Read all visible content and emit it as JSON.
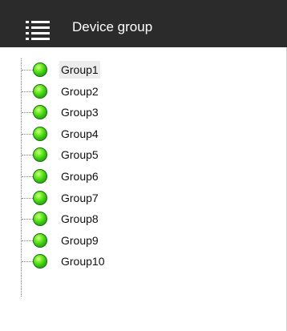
{
  "header": {
    "icon": "list-icon",
    "title": "Device group"
  },
  "tree": {
    "status_color": "#33c20f",
    "selected_index": 0,
    "items": [
      {
        "label": "Group1",
        "status": "online"
      },
      {
        "label": "Group2",
        "status": "online"
      },
      {
        "label": "Group3",
        "status": "online"
      },
      {
        "label": "Group4",
        "status": "online"
      },
      {
        "label": "Group5",
        "status": "online"
      },
      {
        "label": "Group6",
        "status": "online"
      },
      {
        "label": "Group7",
        "status": "online"
      },
      {
        "label": "Group8",
        "status": "online"
      },
      {
        "label": "Group9",
        "status": "online"
      },
      {
        "label": "Group10",
        "status": "online"
      }
    ]
  }
}
